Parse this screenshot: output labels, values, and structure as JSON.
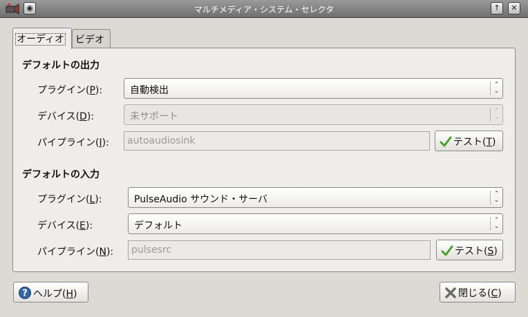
{
  "window": {
    "title": "マルチメディア・システム・セレクタ",
    "up_button": "↑",
    "close_button": "✕",
    "menu_button": "◉"
  },
  "tabs": [
    {
      "label": "オーディオ",
      "active": true
    },
    {
      "label": "ビデオ",
      "active": false
    }
  ],
  "output": {
    "title": "デフォルトの出力",
    "plugin_label": "プラグイン(",
    "plugin_key": "P",
    "plugin_value": "自動検出",
    "device_label": "デバイス(",
    "device_key": "D",
    "device_value": "未サポート",
    "pipeline_label": "パイプライン(",
    "pipeline_key": "I",
    "pipeline_value": "autoaudiosink",
    "test_label": "テスト(",
    "test_key": "T"
  },
  "input": {
    "title": "デフォルトの入力",
    "plugin_label": "プラグイン(",
    "plugin_key": "L",
    "plugin_value": "PulseAudio サウンド・サーバ",
    "device_label": "デバイス(",
    "device_key": "E",
    "device_value": "デフォルト",
    "pipeline_label": "パイプライン(",
    "pipeline_key": "N",
    "pipeline_value": "pulsesrc",
    "test_label": "テスト(",
    "test_key": "S"
  },
  "footer": {
    "help_label": "ヘルプ(",
    "help_key": "H",
    "close_label": "閉じる(",
    "close_key": "C"
  },
  "label_suffix": "):",
  "button_suffix": ")",
  "colors": {
    "titlebar": "#7f7f7f",
    "window_bg": "#dcdad5",
    "check_green": "#4aa02c",
    "help_blue": "#3465a4"
  }
}
